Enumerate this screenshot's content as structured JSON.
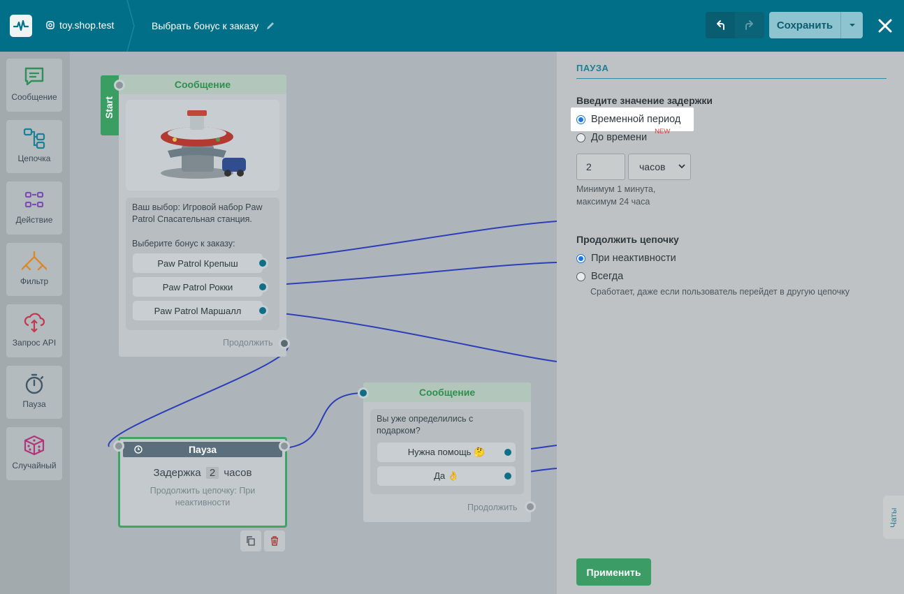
{
  "header": {
    "account": "toy.shop.test",
    "flow_title": "Выбрать бонус к заказу",
    "save_label": "Сохранить"
  },
  "sidebar": {
    "items": [
      {
        "label": "Сообщение",
        "icon": "message-icon"
      },
      {
        "label": "Цепочка",
        "icon": "chain-icon"
      },
      {
        "label": "Действие",
        "icon": "action-icon"
      },
      {
        "label": "Фильтр",
        "icon": "filter-icon"
      },
      {
        "label": "Запрос API",
        "icon": "api-request-icon"
      },
      {
        "label": "Пауза",
        "icon": "timer-icon"
      },
      {
        "label": "Случайный",
        "icon": "dice-icon"
      }
    ]
  },
  "canvas": {
    "start_label": "Start",
    "node1": {
      "title": "Сообщение",
      "text1": "Ваш выбор: Игровой набор Paw Patrol Спасательная станция.",
      "text2": "Выберите бонус к заказу:",
      "buttons": [
        "Paw Patrol Крепыш",
        "Paw Patrol Рокки",
        "Paw Patrol Маршалл"
      ],
      "continue_label": "Продолжить"
    },
    "pause_node": {
      "title": "Пауза",
      "delay_prefix": "Задержка",
      "delay_value": "2",
      "delay_unit": "часов",
      "subtitle": "Продолжить цепочку: При неактивности"
    },
    "node2": {
      "title": "Сообщение",
      "text": "Вы уже определились с подарком?",
      "buttons": [
        "Нужна помощь 🤔",
        "Да 👌"
      ],
      "continue_label": "Продолжить"
    }
  },
  "panel": {
    "title": "ПАУЗА",
    "delay_heading": "Введите значение задержки",
    "option_period": "Временной период",
    "option_until": "До времени",
    "new_badge": "NEW",
    "delay_value": "2",
    "unit_value": "часов",
    "hint_line1": "Минимум 1 минута,",
    "hint_line2": "максимум 24 часа",
    "continue_heading": "Продолжить цепочку",
    "option_inactive": "При неактивности",
    "option_always": "Всегда",
    "always_hint": "Сработает, даже если пользователь перейдет в другую цепочку",
    "apply_label": "Применить",
    "chats_label": "Чаты"
  },
  "colors": {
    "header": "#006f87",
    "accent_green": "#3b9c66",
    "wire": "#2d3fb8"
  }
}
